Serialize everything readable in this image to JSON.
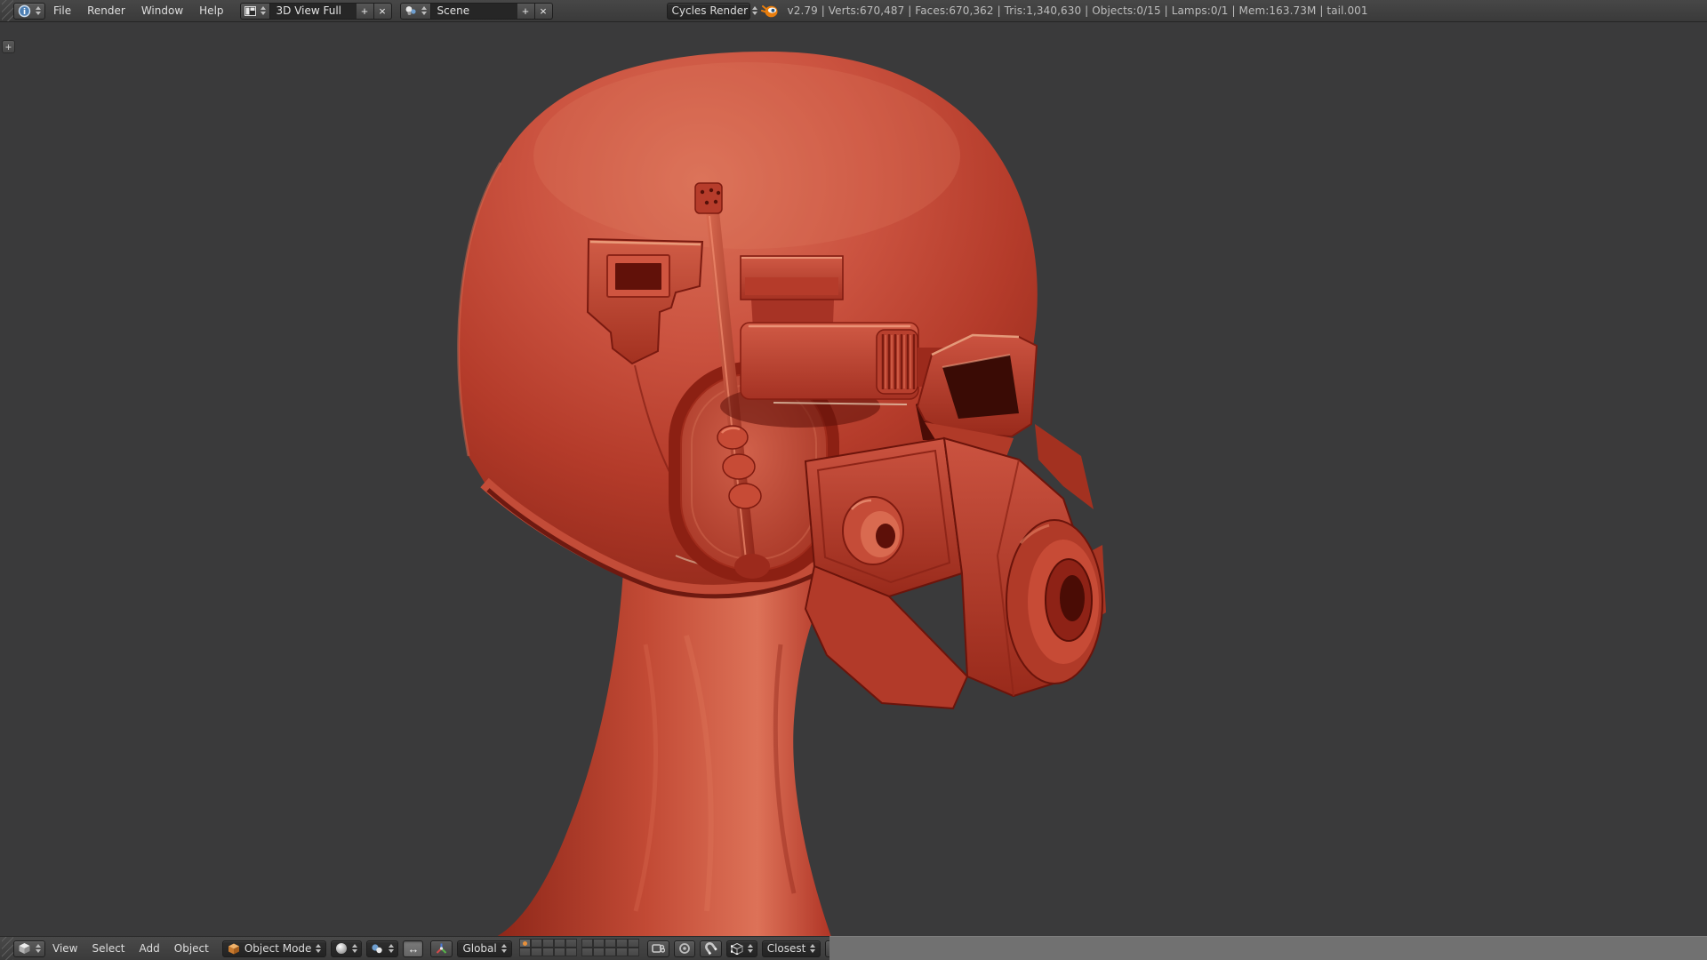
{
  "top_bar": {
    "menus": [
      "File",
      "Render",
      "Window",
      "Help"
    ],
    "layout_selector": {
      "value": "3D View Full",
      "add_label": "+",
      "close_label": "×"
    },
    "scene_selector": {
      "value": "Scene",
      "add_label": "+",
      "close_label": "×"
    },
    "engine_selector": {
      "value": "Cycles Render"
    },
    "stats": "v2.79 | Verts:670,487 | Faces:670,362 | Tris:1,340,630 | Objects:0/15 | Lamps:0/1 | Mem:163.73M | tail.001"
  },
  "viewport": {
    "expand_region_label": "+"
  },
  "bottom_bar": {
    "menus": [
      "View",
      "Select",
      "Add",
      "Object"
    ],
    "mode_selector": {
      "value": "Object Mode"
    },
    "orientation_selector": {
      "value": "Global"
    },
    "snap_target_selector": {
      "value": "Closest"
    },
    "manipulator_toggle_glyph": "↔",
    "layers": {
      "groups": 2,
      "per_group": 10,
      "active_index": 0
    }
  },
  "colors": {
    "model_red": "#c24534",
    "viewport_bg": "#3a3a3b",
    "header_dark": "#3d3d3d",
    "header_light": "#717171",
    "active_layer_dot": "#e8903a"
  }
}
